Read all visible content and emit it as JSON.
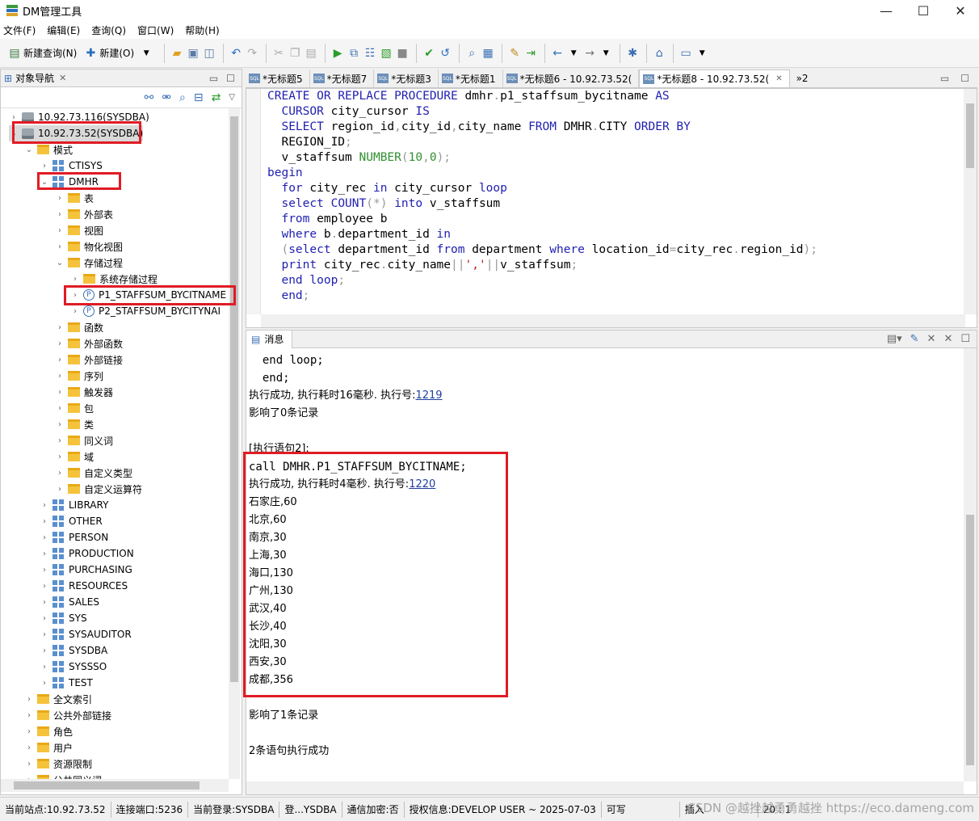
{
  "window": {
    "title": "DM管理工具",
    "minimize": "—",
    "maximize": "☐",
    "close": "✕"
  },
  "menu": [
    "文件(F)",
    "编辑(E)",
    "查询(Q)",
    "窗口(W)",
    "帮助(H)"
  ],
  "toolbar": {
    "new_query": "新建查询(N)",
    "new": "新建(O)"
  },
  "left_panel": {
    "tab_label": "对象导航",
    "tab_close": "✕"
  },
  "tree": [
    {
      "label": "10.92.73.116(SYSDBA)",
      "level": 0,
      "icon": "db",
      "twisty": "›"
    },
    {
      "label": "10.92.73.52(SYSDBA)",
      "level": 0,
      "icon": "db",
      "twisty": "⌄"
    },
    {
      "label": "模式",
      "level": 1,
      "icon": "folder",
      "twisty": "⌄"
    },
    {
      "label": "CTISYS",
      "level": 2,
      "icon": "schema",
      "twisty": "›"
    },
    {
      "label": "DMHR",
      "level": 2,
      "icon": "schema",
      "twisty": "⌄"
    },
    {
      "label": "表",
      "level": 3,
      "icon": "folder",
      "twisty": "›"
    },
    {
      "label": "外部表",
      "level": 3,
      "icon": "folder",
      "twisty": "›"
    },
    {
      "label": "视图",
      "level": 3,
      "icon": "folder",
      "twisty": "›"
    },
    {
      "label": "物化视图",
      "level": 3,
      "icon": "folder",
      "twisty": "›"
    },
    {
      "label": "存储过程",
      "level": 3,
      "icon": "folder",
      "twisty": "⌄"
    },
    {
      "label": "系统存储过程",
      "level": 4,
      "icon": "folder",
      "twisty": "›"
    },
    {
      "label": "P1_STAFFSUM_BYCITNAME",
      "level": 4,
      "icon": "proc",
      "twisty": "›"
    },
    {
      "label": "P2_STAFFSUM_BYCITYNAI",
      "level": 4,
      "icon": "proc",
      "twisty": "›"
    },
    {
      "label": "函数",
      "level": 3,
      "icon": "folder",
      "twisty": "›"
    },
    {
      "label": "外部函数",
      "level": 3,
      "icon": "folder",
      "twisty": "›"
    },
    {
      "label": "外部链接",
      "level": 3,
      "icon": "folder",
      "twisty": "›"
    },
    {
      "label": "序列",
      "level": 3,
      "icon": "folder",
      "twisty": "›"
    },
    {
      "label": "触发器",
      "level": 3,
      "icon": "folder",
      "twisty": "›"
    },
    {
      "label": "包",
      "level": 3,
      "icon": "folder",
      "twisty": "›"
    },
    {
      "label": "类",
      "level": 3,
      "icon": "folder",
      "twisty": "›"
    },
    {
      "label": "同义词",
      "level": 3,
      "icon": "folder",
      "twisty": "›"
    },
    {
      "label": "域",
      "level": 3,
      "icon": "folder",
      "twisty": "›"
    },
    {
      "label": "自定义类型",
      "level": 3,
      "icon": "folder",
      "twisty": "›"
    },
    {
      "label": "自定义运算符",
      "level": 3,
      "icon": "folder",
      "twisty": "›"
    },
    {
      "label": "LIBRARY",
      "level": 2,
      "icon": "schema",
      "twisty": "›"
    },
    {
      "label": "OTHER",
      "level": 2,
      "icon": "schema",
      "twisty": "›"
    },
    {
      "label": "PERSON",
      "level": 2,
      "icon": "schema",
      "twisty": "›"
    },
    {
      "label": "PRODUCTION",
      "level": 2,
      "icon": "schema",
      "twisty": "›"
    },
    {
      "label": "PURCHASING",
      "level": 2,
      "icon": "schema",
      "twisty": "›"
    },
    {
      "label": "RESOURCES",
      "level": 2,
      "icon": "schema",
      "twisty": "›"
    },
    {
      "label": "SALES",
      "level": 2,
      "icon": "schema",
      "twisty": "›"
    },
    {
      "label": "SYS",
      "level": 2,
      "icon": "schema",
      "twisty": "›"
    },
    {
      "label": "SYSAUDITOR",
      "level": 2,
      "icon": "schema",
      "twisty": "›"
    },
    {
      "label": "SYSDBA",
      "level": 2,
      "icon": "schema",
      "twisty": "›"
    },
    {
      "label": "SYSSSO",
      "level": 2,
      "icon": "schema",
      "twisty": "›"
    },
    {
      "label": "TEST",
      "level": 2,
      "icon": "schema",
      "twisty": "›"
    },
    {
      "label": "全文索引",
      "level": 1,
      "icon": "folder",
      "twisty": "›"
    },
    {
      "label": "公共外部链接",
      "level": 1,
      "icon": "folder",
      "twisty": "›"
    },
    {
      "label": "角色",
      "level": 1,
      "icon": "folder",
      "twisty": "›"
    },
    {
      "label": "用户",
      "level": 1,
      "icon": "folder",
      "twisty": "›"
    },
    {
      "label": "资源限制",
      "level": 1,
      "icon": "folder",
      "twisty": "›"
    },
    {
      "label": "公共同义词",
      "level": 1,
      "icon": "folder",
      "twisty": "›"
    }
  ],
  "editor_tabs": [
    {
      "label": "*无标题5",
      "active": false
    },
    {
      "label": "*无标题7",
      "active": false
    },
    {
      "label": "*无标题3",
      "active": false
    },
    {
      "label": "*无标题1",
      "active": false
    },
    {
      "label": "*无标题6 - 10.92.73.52(",
      "active": false
    },
    {
      "label": "*无标题8 - 10.92.73.52(",
      "active": true
    }
  ],
  "editor_tabs_overflow": "»2",
  "code_lines": [
    [
      [
        "kw",
        "CREATE"
      ],
      [
        "t",
        " "
      ],
      [
        "kw",
        "OR"
      ],
      [
        "t",
        " "
      ],
      [
        "kw",
        "REPLACE"
      ],
      [
        "t",
        " "
      ],
      [
        "kw",
        "PROCEDURE"
      ],
      [
        "t",
        " dmhr"
      ],
      [
        "op",
        "."
      ],
      [
        "t",
        "p1_staffsum_bycitname "
      ],
      [
        "kw",
        "AS"
      ]
    ],
    [
      [
        "t",
        "  "
      ],
      [
        "kw",
        "CURSOR"
      ],
      [
        "t",
        " city_cursor "
      ],
      [
        "kw",
        "IS"
      ]
    ],
    [
      [
        "t",
        "  "
      ],
      [
        "kw",
        "SELECT"
      ],
      [
        "t",
        " region_id"
      ],
      [
        "op",
        ","
      ],
      [
        "t",
        "city_id"
      ],
      [
        "op",
        ","
      ],
      [
        "t",
        "city_name "
      ],
      [
        "kw",
        "FROM"
      ],
      [
        "t",
        " DMHR"
      ],
      [
        "op",
        "."
      ],
      [
        "t",
        "CITY "
      ],
      [
        "kw",
        "ORDER"
      ],
      [
        "t",
        " "
      ],
      [
        "kw",
        "BY"
      ]
    ],
    [
      [
        "t",
        "  REGION_ID"
      ],
      [
        "op",
        ";"
      ]
    ],
    [
      [
        "t",
        "  v_staffsum "
      ],
      [
        "num",
        "NUMBER"
      ],
      [
        "op",
        "("
      ],
      [
        "num",
        "10"
      ],
      [
        "op",
        ","
      ],
      [
        "num",
        "0"
      ],
      [
        "op",
        ");"
      ]
    ],
    [
      [
        "kw",
        "begin"
      ]
    ],
    [
      [
        "t",
        "  "
      ],
      [
        "kw",
        "for"
      ],
      [
        "t",
        " city_rec "
      ],
      [
        "kw",
        "in"
      ],
      [
        "t",
        " city_cursor "
      ],
      [
        "kw",
        "loop"
      ]
    ],
    [
      [
        "t",
        "  "
      ],
      [
        "kw",
        "select"
      ],
      [
        "t",
        " "
      ],
      [
        "kw",
        "COUNT"
      ],
      [
        "op",
        "(*)"
      ],
      [
        "t",
        " "
      ],
      [
        "kw",
        "into"
      ],
      [
        "t",
        " v_staffsum"
      ]
    ],
    [
      [
        "t",
        "  "
      ],
      [
        "kw",
        "from"
      ],
      [
        "t",
        " employee b"
      ]
    ],
    [
      [
        "t",
        "  "
      ],
      [
        "kw",
        "where"
      ],
      [
        "t",
        " b"
      ],
      [
        "op",
        "."
      ],
      [
        "t",
        "department_id "
      ],
      [
        "kw",
        "in"
      ]
    ],
    [
      [
        "t",
        "  "
      ],
      [
        "op",
        "("
      ],
      [
        "kw",
        "select"
      ],
      [
        "t",
        " department_id "
      ],
      [
        "kw",
        "from"
      ],
      [
        "t",
        " department "
      ],
      [
        "kw",
        "where"
      ],
      [
        "t",
        " location_id"
      ],
      [
        "op",
        "="
      ],
      [
        "t",
        "city_rec"
      ],
      [
        "op",
        "."
      ],
      [
        "t",
        "region_id"
      ],
      [
        "op",
        ");"
      ]
    ],
    [
      [
        "t",
        "  "
      ],
      [
        "kw",
        "print"
      ],
      [
        "t",
        " city_rec"
      ],
      [
        "op",
        "."
      ],
      [
        "t",
        "city_name"
      ],
      [
        "op",
        "||"
      ],
      [
        "str",
        "','"
      ],
      [
        "op",
        "||"
      ],
      [
        "t",
        "v_staffsum"
      ],
      [
        "op",
        ";"
      ]
    ],
    [
      [
        "t",
        "  "
      ],
      [
        "kw",
        "end"
      ],
      [
        "t",
        " "
      ],
      [
        "kw",
        "loop"
      ],
      [
        "op",
        ";"
      ]
    ],
    [
      [
        "t",
        "  "
      ],
      [
        "kw",
        "end"
      ],
      [
        "op",
        ";"
      ]
    ]
  ],
  "messages": {
    "tab_label": "消息",
    "lines": [
      {
        "type": "code",
        "text": "  end loop;"
      },
      {
        "type": "code",
        "text": "  end;"
      },
      {
        "type": "exec",
        "text": "执行成功, 执行耗时16毫秒. 执行号:",
        "link": "1219"
      },
      {
        "type": "text",
        "text": "影响了0条记录"
      },
      {
        "type": "blank",
        "text": ""
      },
      {
        "type": "text",
        "text": "[执行语句2]:"
      },
      {
        "type": "code",
        "text": "call DMHR.P1_STAFFSUM_BYCITNAME;"
      },
      {
        "type": "exec",
        "text": "执行成功, 执行耗时4毫秒. 执行号:",
        "link": "1220"
      },
      {
        "type": "text",
        "text": "石家庄,60"
      },
      {
        "type": "text",
        "text": "北京,60"
      },
      {
        "type": "text",
        "text": "南京,30"
      },
      {
        "type": "text",
        "text": "上海,30"
      },
      {
        "type": "text",
        "text": "海口,130"
      },
      {
        "type": "text",
        "text": "广州,130"
      },
      {
        "type": "text",
        "text": "武汉,40"
      },
      {
        "type": "text",
        "text": "长沙,40"
      },
      {
        "type": "text",
        "text": "沈阳,30"
      },
      {
        "type": "text",
        "text": "西安,30"
      },
      {
        "type": "text",
        "text": "成都,356"
      },
      {
        "type": "blank",
        "text": ""
      },
      {
        "type": "text",
        "text": "影响了1条记录"
      },
      {
        "type": "blank",
        "text": ""
      },
      {
        "type": "text",
        "text": "2条语句执行成功"
      }
    ]
  },
  "status": [
    "当前站点:10.92.73.52",
    "连接端口:5236",
    "当前登录:SYSDBA",
    "登...YSDBA",
    "通信加密:否",
    "授权信息:DEVELOP USER ~ 2025-07-03",
    "可写",
    "插入",
    "20 : 1"
  ],
  "watermark": "CSDN @越挫越勇勇越挫 https://eco.dameng.com",
  "colors": {
    "highlight": "#e01b24",
    "keyword": "#1f1fb0",
    "link": "#1f3f9f"
  }
}
